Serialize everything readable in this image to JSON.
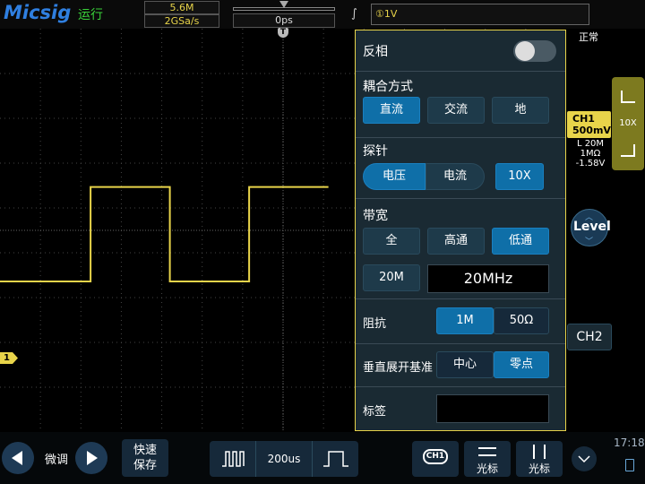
{
  "header": {
    "logo": "Micsig",
    "status": "运行",
    "memory_depth": "5.6M",
    "sample_rate": "2GSa/s",
    "time_offset": "0ps",
    "trigger_edge_icon": "rising-edge-icon",
    "trigger_source": "①1V",
    "trigger_mode": "正常"
  },
  "markers": {
    "trigger_marker": "T",
    "ch1_marker": "1"
  },
  "menu": {
    "invert": {
      "label": "反相",
      "on": false
    },
    "coupling": {
      "label": "耦合方式",
      "options": [
        "直流",
        "交流",
        "地"
      ],
      "selected": "直流"
    },
    "probe": {
      "label": "探针",
      "options": [
        "电压",
        "电流"
      ],
      "selected": "电压",
      "ratio": "10X"
    },
    "bandwidth": {
      "label": "带宽",
      "options": [
        "全",
        "高通",
        "低通"
      ],
      "selected": "低通",
      "limit_button": "20M",
      "value": "20MHz"
    },
    "impedance": {
      "label": "阻抗",
      "options": [
        "1M",
        "50Ω"
      ],
      "selected": "1M"
    },
    "vertical_expand": {
      "label": "垂直展开基准",
      "options": [
        "中心",
        "零点"
      ],
      "selected": "零点"
    },
    "tag": {
      "label": "标签",
      "value": ""
    }
  },
  "right": {
    "probe_ratio": "10X",
    "ch1_name": "CH1",
    "ch1_scale": "500mV",
    "ch1_bandwidth": "L 20M",
    "ch1_impedance": "1MΩ",
    "ch1_offset": "-1.58V",
    "level_label": "Level",
    "ch2_label": "CH2"
  },
  "bottom": {
    "fine_label": "微调",
    "quick_save": [
      "快速",
      "保存"
    ],
    "timebase": "200us",
    "ch1_badge": "CH1",
    "cursor_label_1": "光标",
    "cursor_label_2": "光标",
    "clock": "17:18"
  },
  "colors": {
    "ch1": "#e8d44a",
    "accent": "#0f6fa8",
    "background": "#000000"
  },
  "chart_data": {
    "type": "line",
    "series": [
      {
        "name": "CH1",
        "x": [
          -1000,
          -680,
          -680,
          -400,
          -400,
          -120,
          -120,
          160
        ],
        "y": [
          -0.25,
          -0.25,
          1.6,
          1.6,
          -0.25,
          -0.25,
          1.6,
          1.6
        ]
      }
    ],
    "title": "",
    "xlabel": "",
    "ylabel": "",
    "xlim": [
      -1000,
      0
    ],
    "ylim": [
      -3.2,
      4.7
    ]
  }
}
